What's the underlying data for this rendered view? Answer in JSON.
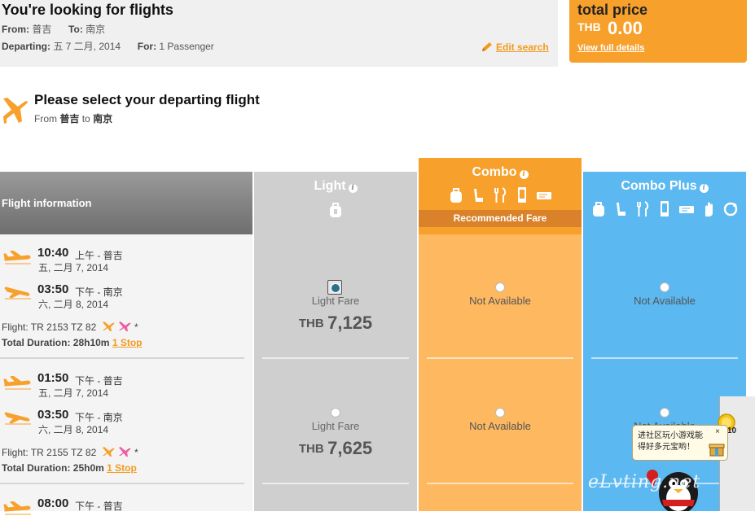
{
  "summary": {
    "title": "You're looking for flights",
    "from_label": "From:",
    "from_value": "普吉",
    "to_label": "To:",
    "to_value": "南京",
    "departing_label": "Departing:",
    "departing_value": "五 7 二月, 2014",
    "for_label": "For:",
    "for_value": "1 Passenger",
    "edit_search": "Edit search"
  },
  "total": {
    "label": "total price",
    "currency": "THB",
    "amount": "0.00",
    "details": "View full details"
  },
  "section": {
    "title": "Please select your departing flight",
    "from_word": "From",
    "from_city": "普吉",
    "to_word": "to",
    "to_city": "南京"
  },
  "columns": {
    "info": "Flight information",
    "light": "Light",
    "combo": "Combo",
    "combo_plus": "Combo Plus",
    "recommended": "Recommended Fare"
  },
  "flights": [
    {
      "dep_time": "10:40",
      "dep_ampm_city": "上午 - 普吉",
      "dep_date": "五, 二月 7, 2014",
      "arr_time": "03:50",
      "arr_ampm_city": "下午 - 南京",
      "arr_date": "六, 二月 8, 2014",
      "flight_no": "Flight: TR 2153 TZ 82",
      "flight_note": "*",
      "duration": "Total Duration: 28h10m",
      "stops": "1 Stop",
      "light_label": "Light Fare",
      "light_currency": "THB",
      "light_price": "7,125",
      "light_selected": true,
      "combo": "Not Available",
      "combo_plus": "Not Available"
    },
    {
      "dep_time": "01:50",
      "dep_ampm_city": "下午 - 普吉",
      "dep_date": "五, 二月 7, 2014",
      "arr_time": "03:50",
      "arr_ampm_city": "下午 - 南京",
      "arr_date": "六, 二月 8, 2014",
      "flight_no": "Flight: TR 2155 TZ 82",
      "flight_note": "*",
      "duration": "Total Duration: 25h0m",
      "stops": "1 Stop",
      "light_label": "Light Fare",
      "light_currency": "THB",
      "light_price": "7,625",
      "light_selected": false,
      "combo": "Not Available",
      "combo_plus": "Not Available"
    },
    {
      "dep_time": "08:00",
      "dep_ampm_city": "下午 - 普吉"
    }
  ],
  "popup": {
    "text": "进社区玩小游戏能得好多元宝哟！",
    "close": "×",
    "coin_count": "10"
  },
  "watermark": "eLvting.net",
  "colors": {
    "orange": "#f7a02c",
    "light_grey": "#cfcfcf",
    "combo_orange": "#fdb860",
    "blue": "#5cb8f0"
  }
}
